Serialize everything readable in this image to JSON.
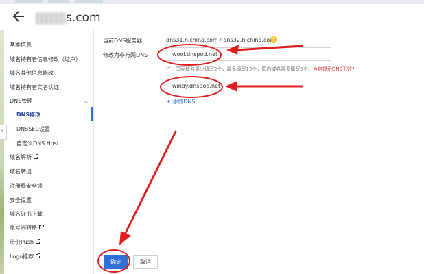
{
  "header": {
    "domain_suffix": "s.com"
  },
  "sidebar": {
    "items": [
      {
        "label": "基本信息"
      },
      {
        "label": "域名持有者信息修改（过户）"
      },
      {
        "label": "域名其他信息修改"
      },
      {
        "label": "域名持有者实名认证"
      },
      {
        "label": "DNS管理"
      },
      {
        "label": "DNS修改"
      },
      {
        "label": "DNSSEC设置"
      },
      {
        "label": "自定义DNS Host"
      },
      {
        "label": "域名解析"
      },
      {
        "label": "域名转出"
      },
      {
        "label": "注册局安全锁"
      },
      {
        "label": "安全设置"
      },
      {
        "label": "域名证书下载"
      },
      {
        "label": "账号间转移"
      },
      {
        "label": "带价Push"
      },
      {
        "label": "Logo推荐"
      }
    ]
  },
  "main": {
    "current_dns_label": "当前DNS服务器",
    "current_dns_value": "dns31.hichina.com / dns32.hichina.com",
    "modify_label": "修改为非万网DNS",
    "dns_input_1": "wool.dnspod.net",
    "note_prefix": "注：国际域名最少填写2个，最多填写13个，国内域名最多填写6个。",
    "note_link": "为何提示DNS无效?",
    "dns_input_2": "windy.dnspod.net",
    "add_dns": "+ 添加DNS"
  },
  "footer": {
    "confirm": "确定",
    "cancel": "取消"
  },
  "colors": {
    "accent": "#2f6fd6",
    "annotation_red": "#e02020",
    "warning": "#f3c22b"
  }
}
